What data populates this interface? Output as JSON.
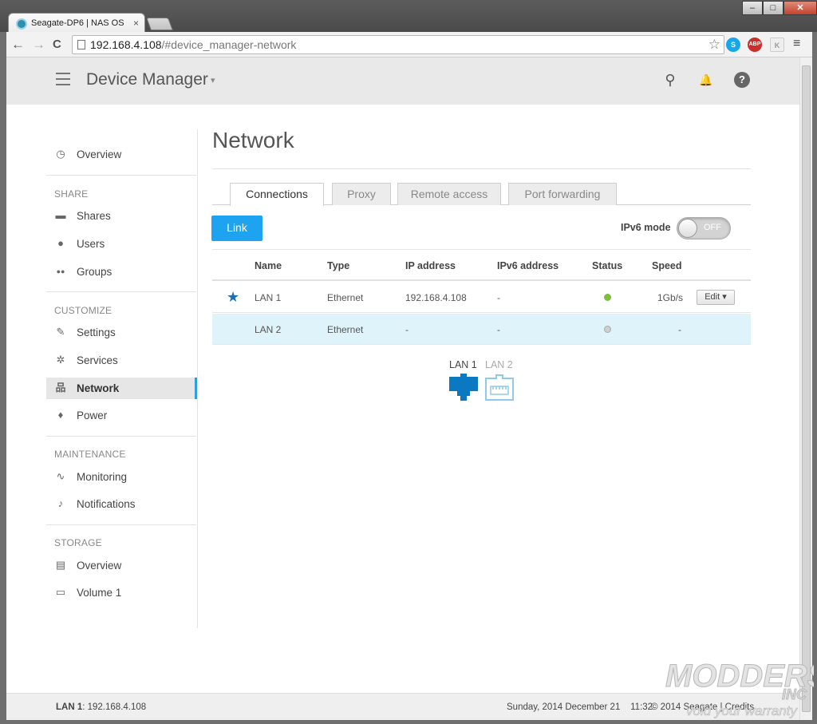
{
  "browser": {
    "tab_title": "Seagate-DP6 | NAS OS",
    "tab_close": "×",
    "win_minimize": "–",
    "win_maximize": "□",
    "win_close": "✕",
    "url_host": "192.168.4.108",
    "url_path": "/#device_manager-network",
    "nav_back": "←",
    "nav_forward": "→",
    "nav_reload": "C",
    "bookmark_star": "☆",
    "ext_skype": "S",
    "ext_abp": "ABP",
    "ext_k": "K",
    "menu": "≡"
  },
  "header": {
    "title": "Device Manager",
    "caret": "▾",
    "search": "⚲",
    "bell": "🔔",
    "help": "?"
  },
  "sidebar": {
    "overview": "Overview",
    "share_heading": "Share",
    "shares": "Shares",
    "users": "Users",
    "groups": "Groups",
    "customize_heading": "Customize",
    "settings": "Settings",
    "services": "Services",
    "network": "Network",
    "power": "Power",
    "maintenance_heading": "Maintenance",
    "monitoring": "Monitoring",
    "notifications": "Notifications",
    "storage_heading": "Storage",
    "storage_overview": "Overview",
    "volume1": "Volume 1",
    "icons": {
      "overview": "◷",
      "shares": "▬",
      "users": "●",
      "groups": "●●",
      "settings": "✎",
      "services": "✲",
      "network": "品",
      "power": "♦",
      "monitoring": "∿",
      "notifications": "♪",
      "storage_overview": "▤",
      "volume1": "▭"
    }
  },
  "main": {
    "title": "Network",
    "tabs": [
      "Connections",
      "Proxy",
      "Remote access",
      "Port forwarding"
    ],
    "link_button": "Link",
    "ipv6_label": "IPv6 mode",
    "ipv6_state": "OFF",
    "ipv6_on": false,
    "columns": [
      "Name",
      "Type",
      "IP address",
      "IPv6 address",
      "Status",
      "Speed"
    ],
    "rows": [
      {
        "name": "LAN 1",
        "type": "Ethernet",
        "ip": "192.168.4.108",
        "ipv6": "-",
        "status_color": "#7bbf3c",
        "speed": "1Gb/s",
        "primary": true
      },
      {
        "name": "LAN 2",
        "type": "Ethernet",
        "ip": "-",
        "ipv6": "-",
        "status_color": "#cfcfcf",
        "speed": "-",
        "primary": false
      }
    ],
    "edit_button": "Edit ▾",
    "primary_star": "★",
    "ports": [
      {
        "label": "LAN 1",
        "active": true,
        "color": "#0b78c2"
      },
      {
        "label": "LAN 2",
        "active": false,
        "color": "#8fcaea"
      }
    ]
  },
  "footer": {
    "lan_label": "LAN 1",
    "lan_ip": ": 192.168.4.108",
    "datetime": "Sunday, 2014 December 21    11:32",
    "copyright": "© 2014 Seagate | Credits"
  },
  "watermark": {
    "line1": "MODDERS",
    "line2": "INC",
    "line3": "void your warranty"
  },
  "colors": {
    "accent": "#1da3ef",
    "active_border": "#2a9fd8",
    "row_highlight": "#dff3fb"
  }
}
